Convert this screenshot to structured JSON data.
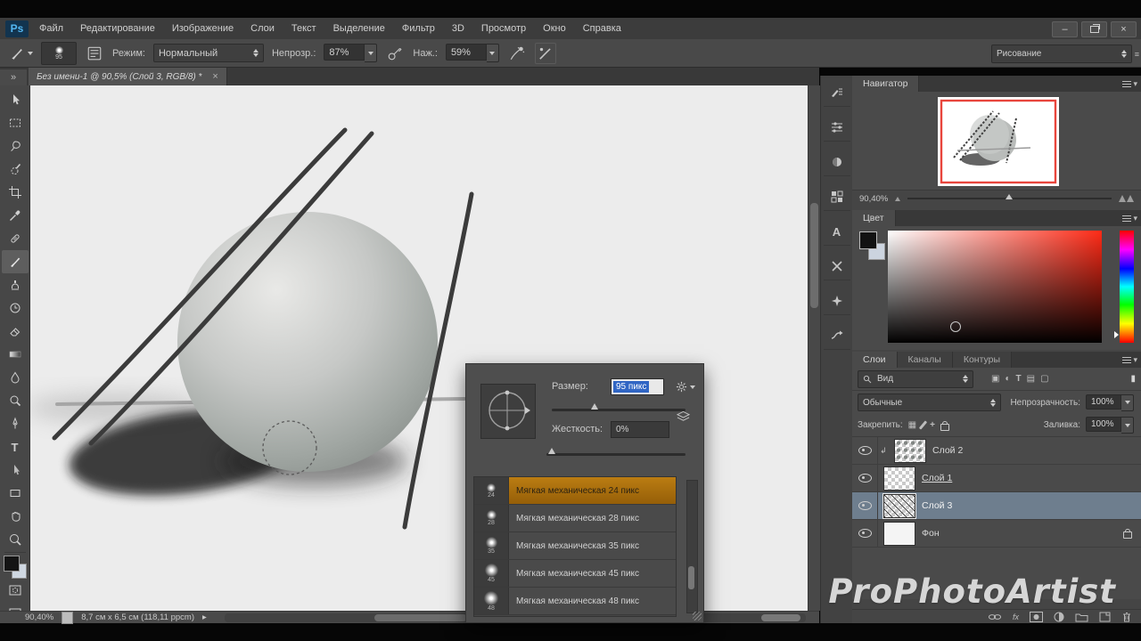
{
  "icons": {
    "logo": "Ps",
    "chevrons": "»",
    "close": "×",
    "minimize": "–",
    "caret_down": "▾",
    "play": "▸",
    "left_arrow": "◂",
    "checker": "▦",
    "plus": "+",
    "type_tool": "T",
    "character": "A",
    "fx": "fx",
    "clip_arrow": "↳"
  },
  "menubar": {
    "menus": [
      "Файл",
      "Редактирование",
      "Изображение",
      "Слои",
      "Текст",
      "Выделение",
      "Фильтр",
      "3D",
      "Просмотр",
      "Окно",
      "Справка"
    ]
  },
  "options_bar": {
    "brush_size": "95",
    "mode_label": "Режим:",
    "mode_value": "Нормальный",
    "opacity_label": "Непрозр.:",
    "opacity_value": "87%",
    "flow_label": "Наж.:",
    "flow_value": "59%",
    "workspace": "Рисование"
  },
  "document_tab": {
    "title": "Без имени-1 @ 90,5% (Слой 3, RGB/8) *"
  },
  "status_bar": {
    "zoom": "90,40%",
    "info": "8,7 см x 6,5 см (118,11 ppcm)"
  },
  "brush_popup": {
    "size_label": "Размер:",
    "size_value": "95 пикс",
    "hardness_label": "Жесткость:",
    "hardness_value": "0%",
    "brushes": [
      {
        "size": "24",
        "name": "Мягкая механическая 24 пикс"
      },
      {
        "size": "28",
        "name": "Мягкая механическая 28 пикс"
      },
      {
        "size": "35",
        "name": "Мягкая механическая 35 пикс"
      },
      {
        "size": "45",
        "name": "Мягкая механическая 45 пикс"
      },
      {
        "size": "48",
        "name": "Мягкая механическая 48 пикс"
      }
    ]
  },
  "navigator": {
    "title": "Навигатор",
    "zoom": "90,40%"
  },
  "color_panel": {
    "title": "Цвет"
  },
  "layers_panel": {
    "tabs": [
      "Слои",
      "Каналы",
      "Контуры"
    ],
    "filter_value": "Вид",
    "blend_mode": "Обычные",
    "opacity_label": "Непрозрачность:",
    "opacity_value": "100%",
    "lock_label": "Закрепить:",
    "fill_label": "Заливка:",
    "fill_value": "100%",
    "layers": [
      {
        "name": "Слой 2"
      },
      {
        "name": "Слой 1"
      },
      {
        "name": "Слой 3"
      },
      {
        "name": "Фон"
      }
    ]
  },
  "watermark": "ProPhotoArtist",
  "colors": {
    "brush_highlight": "#b0740f",
    "selected_layer": "#6e7e8e",
    "navigator_border": "#e8453c",
    "size_selection": "#3166c4",
    "hue_base": "#ff2b17"
  }
}
